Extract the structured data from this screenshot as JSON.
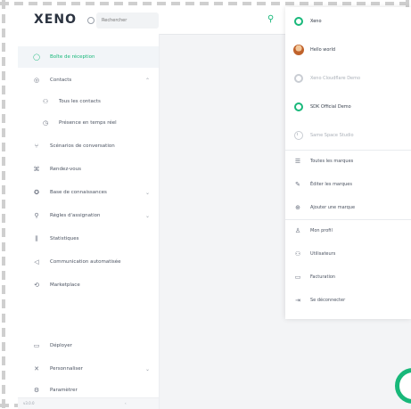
{
  "app": {
    "logo": "XENO",
    "search_placeholder": "Rechercher",
    "accent_color": "#18b87a"
  },
  "sidebar": {
    "items": [
      {
        "label": "Boîte de réception",
        "icon": "chat-icon",
        "active": true
      },
      {
        "label": "Contacts",
        "icon": "contacts-icon",
        "chevron": true
      },
      {
        "label": "Tous les contacts",
        "icon": "users-icon",
        "sub": true
      },
      {
        "label": "Présence en temps réel",
        "icon": "presence-icon",
        "sub": true
      },
      {
        "label": "Scénarios de conversation",
        "icon": "scenario-icon"
      },
      {
        "label": "Rendez-vous",
        "icon": "calendar-icon"
      },
      {
        "label": "Base de connaissances",
        "icon": "knowledge-icon",
        "chevron": true
      },
      {
        "label": "Règles d'assignation",
        "icon": "rules-icon",
        "chevron": true
      },
      {
        "label": "Statistiques",
        "icon": "stats-icon"
      },
      {
        "label": "Communication automatisée",
        "icon": "megaphone-icon"
      },
      {
        "label": "Marketplace",
        "icon": "marketplace-icon"
      },
      {
        "label": "Déployer",
        "icon": "deploy-icon"
      },
      {
        "label": "Personnaliser",
        "icon": "customize-icon",
        "chevron": true
      },
      {
        "label": "Paramètrer",
        "icon": "settings-icon"
      }
    ],
    "footer_text": "v3.0.0"
  },
  "brands": [
    {
      "label": "Xeno",
      "style": "ring"
    },
    {
      "label": "Hello world",
      "style": "avatar"
    },
    {
      "label": "Xeno Cloudflare Demo",
      "style": "ring-muted"
    },
    {
      "label": "SDK Official Demo",
      "style": "ring"
    },
    {
      "label": "Same Space Studio",
      "style": "ring-half"
    }
  ],
  "brand_actions": [
    {
      "label": "Toutes les marques",
      "icon": "list-icon"
    },
    {
      "label": "Éditer les marques",
      "icon": "edit-icon"
    },
    {
      "label": "Ajouter une marque",
      "icon": "add-icon"
    }
  ],
  "account_actions": [
    {
      "label": "Mon profil",
      "icon": "user-icon"
    },
    {
      "label": "Utilisateurs",
      "icon": "team-icon"
    },
    {
      "label": "Facturation",
      "icon": "billing-icon"
    },
    {
      "label": "Se déconnecter",
      "icon": "logout-icon"
    }
  ]
}
